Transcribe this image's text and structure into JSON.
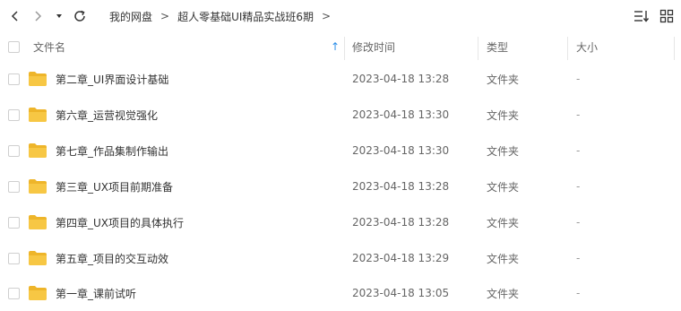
{
  "nav": {
    "back_icon": "chevron-left-icon",
    "forward_icon": "chevron-right-icon",
    "history_icon": "caret-down-icon",
    "refresh_icon": "refresh-icon"
  },
  "breadcrumb": {
    "items": [
      "我的网盘",
      "超人零基础UI精品实战班6期"
    ],
    "separator": ">"
  },
  "toolbar_right": {
    "sort_icon": "sort-list-icon",
    "view_icon": "grid-view-icon"
  },
  "table": {
    "columns": {
      "name": "文件名",
      "modified": "修改时间",
      "type": "类型",
      "size": "大小"
    },
    "sort_indicator": "↑",
    "rows": [
      {
        "name": "第二章_UI界面设计基础",
        "modified": "2023-04-18 13:28",
        "type": "文件夹",
        "size": "-"
      },
      {
        "name": "第六章_运营视觉强化",
        "modified": "2023-04-18 13:30",
        "type": "文件夹",
        "size": "-"
      },
      {
        "name": "第七章_作品集制作输出",
        "modified": "2023-04-18 13:30",
        "type": "文件夹",
        "size": "-"
      },
      {
        "name": "第三章_UX项目前期准备",
        "modified": "2023-04-18 13:28",
        "type": "文件夹",
        "size": "-"
      },
      {
        "name": "第四章_UX项目的具体执行",
        "modified": "2023-04-18 13:28",
        "type": "文件夹",
        "size": "-"
      },
      {
        "name": "第五章_项目的交互动效",
        "modified": "2023-04-18 13:29",
        "type": "文件夹",
        "size": "-"
      },
      {
        "name": "第一章_课前试听",
        "modified": "2023-04-18 13:05",
        "type": "文件夹",
        "size": "-"
      }
    ]
  },
  "colors": {
    "folder": "#f7c744",
    "folder_tab": "#eeb52a",
    "sort_arrow": "#2a8de8",
    "divider": "#e6e6e6"
  }
}
